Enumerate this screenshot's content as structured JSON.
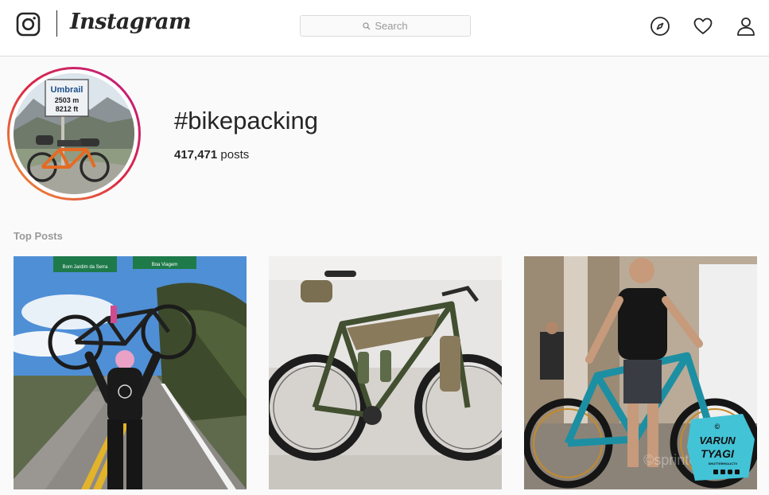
{
  "header": {
    "wordmark": "Instagram",
    "search": {
      "placeholder": "Search"
    },
    "nav": [
      {
        "name": "explore",
        "icon": "compass-icon"
      },
      {
        "name": "activity",
        "icon": "heart-icon"
      },
      {
        "name": "profile",
        "icon": "user-icon"
      }
    ]
  },
  "hashtag": {
    "title": "#bikepacking",
    "post_count": "417,471",
    "post_suffix": " posts",
    "avatar_sign": {
      "line1": "Umbrail",
      "line2": "2503 m",
      "line3": "8212 ft"
    }
  },
  "top_posts": {
    "label": "Top Posts",
    "posts": [
      {
        "sign_left": "Bom Jardim da Serra",
        "sign_right": "Boa Viagem"
      },
      {},
      {
        "badge_name": "VARUN",
        "badge_surname": "TYAGI",
        "badge_copy": "©",
        "badge_tagline": "SHUTTERHOLICTV",
        "watermark": "©sprintcycl"
      }
    ]
  },
  "colors": {
    "ring_start": "#f09433",
    "ring_end": "#bc1888",
    "text": "#262626",
    "muted": "#999999",
    "border": "#dbdbdb"
  }
}
